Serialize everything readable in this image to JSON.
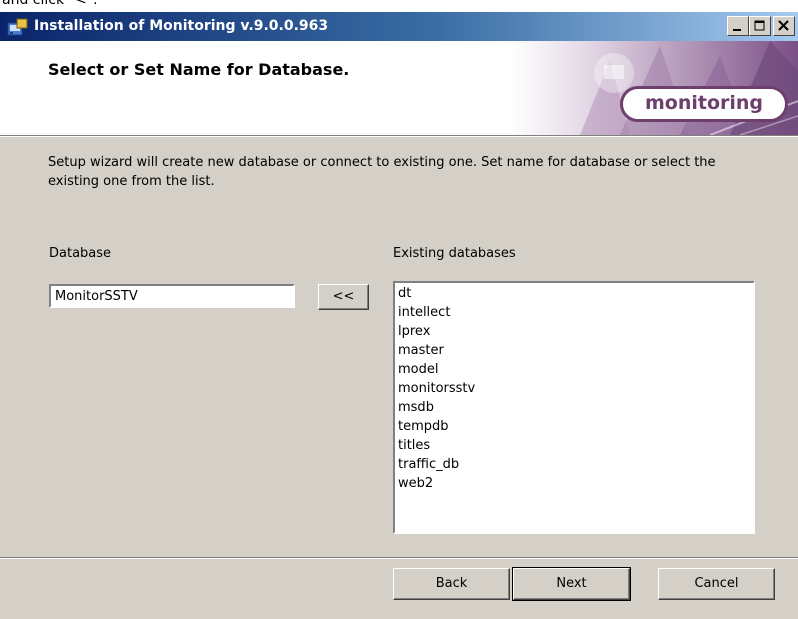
{
  "top_strip_text": "and click \"<\".",
  "window": {
    "title": "Installation of Monitoring v.9.0.0.963",
    "controls": [
      "minimize-icon",
      "maximize-icon",
      "close-icon"
    ]
  },
  "header": {
    "heading": "Select or Set Name for Database.",
    "logo_text": "monitoring"
  },
  "description": "Setup wizard will create new database or connect to existing one. Set name for database or select the existing one from the list.",
  "database": {
    "label": "Database",
    "value": "MonitorSSTV",
    "copy_button_label": "<<"
  },
  "existing": {
    "label": "Existing databases",
    "items": [
      "dt",
      "intellect",
      "lprex",
      "master",
      "model",
      "monitorsstv",
      "msdb",
      "tempdb",
      "titles",
      "traffic_db",
      "web2"
    ]
  },
  "footer": {
    "back_label": "Back",
    "next_label": "Next",
    "cancel_label": "Cancel"
  },
  "colors": {
    "dialog_bg": "#d4d0c8",
    "titlebar_start": "#0a246a",
    "titlebar_end": "#a6caf0",
    "logo_accent": "#6c3f6c"
  }
}
